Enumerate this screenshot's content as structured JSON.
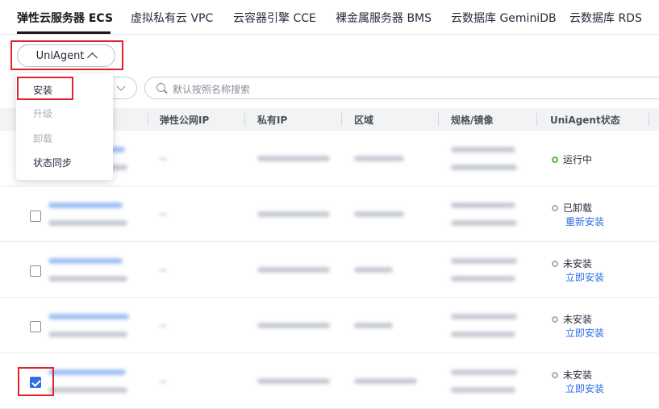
{
  "tabs": [
    {
      "label": "弹性云服务器 ECS"
    },
    {
      "label": "虚拟私有云 VPC"
    },
    {
      "label": "云容器引擎 CCE"
    },
    {
      "label": "裸金属服务器 BMS"
    },
    {
      "label": "云数据库 GeminiDB"
    },
    {
      "label": "云数据库 RDS"
    }
  ],
  "toolbar": {
    "uniagent_button": "UniAgent",
    "search_placeholder": "默认按照名称搜索"
  },
  "menu": {
    "install": "安装",
    "upgrade": "升级",
    "uninstall": "卸载",
    "sync_status": "状态同步"
  },
  "table": {
    "columns": [
      "弹性公网IP",
      "私有IP",
      "区域",
      "规格/镜像",
      "UniAgent状态"
    ],
    "rows": [
      {
        "status": "运行中",
        "status_color": "#5fb43b",
        "action": "",
        "checked": false
      },
      {
        "status": "已卸载",
        "status_color": "#a8adb6",
        "action": "重新安装",
        "checked": false
      },
      {
        "status": "未安装",
        "status_color": "#a8adb6",
        "action": "立即安装",
        "checked": false
      },
      {
        "status": "未安装",
        "status_color": "#a8adb6",
        "action": "立即安装",
        "checked": false
      },
      {
        "status": "未安装",
        "status_color": "#a8adb6",
        "action": "立即安装",
        "checked": true
      }
    ]
  },
  "colors": {
    "accent": "#2f6fe4",
    "highlight_box": "#e0242f",
    "running": "#5fb43b"
  }
}
